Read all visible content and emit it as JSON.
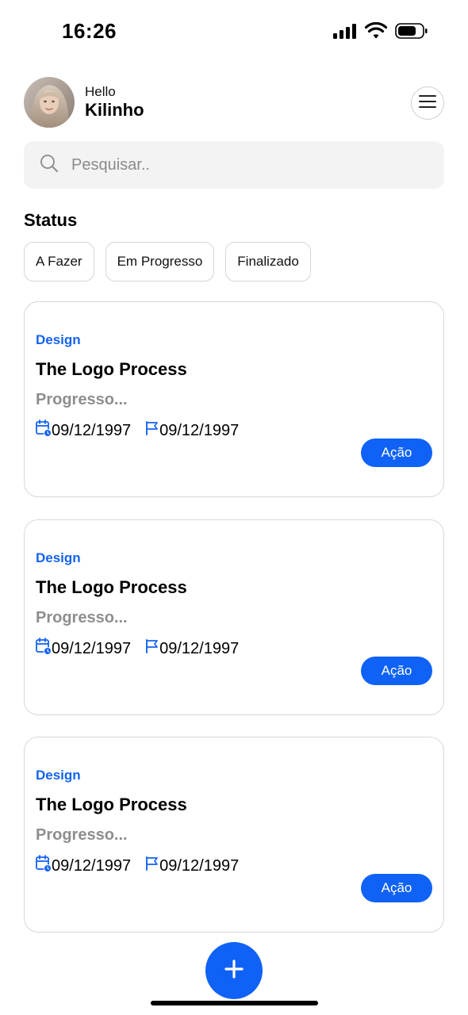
{
  "status_bar": {
    "time": "16:26"
  },
  "header": {
    "greeting": "Hello",
    "username": "Kilinho"
  },
  "search": {
    "placeholder": "Pesquisar.."
  },
  "status_section": {
    "title": "Status",
    "chips": [
      "A Fazer",
      "Em Progresso",
      "Finalizado"
    ]
  },
  "tasks": [
    {
      "category": "Design",
      "title": "The Logo Process",
      "progress": "Progresso...",
      "start_date": "09/12/1997",
      "due_date": "09/12/1997",
      "action_label": "Ação"
    },
    {
      "category": "Design",
      "title": "The Logo Process",
      "progress": "Progresso...",
      "start_date": "09/12/1997",
      "due_date": "09/12/1997",
      "action_label": "Ação"
    },
    {
      "category": "Design",
      "title": "The Logo Process",
      "progress": "Progresso...",
      "start_date": "09/12/1997",
      "due_date": "09/12/1997",
      "action_label": "Ação"
    }
  ],
  "colors": {
    "accent": "#0f62f5",
    "category": "#1463f3",
    "muted": "#8e8e8e"
  },
  "icons": [
    "signal-icon",
    "wifi-icon",
    "battery-icon",
    "menu-icon",
    "search-icon",
    "calendar-icon",
    "flag-icon",
    "plus-icon"
  ]
}
